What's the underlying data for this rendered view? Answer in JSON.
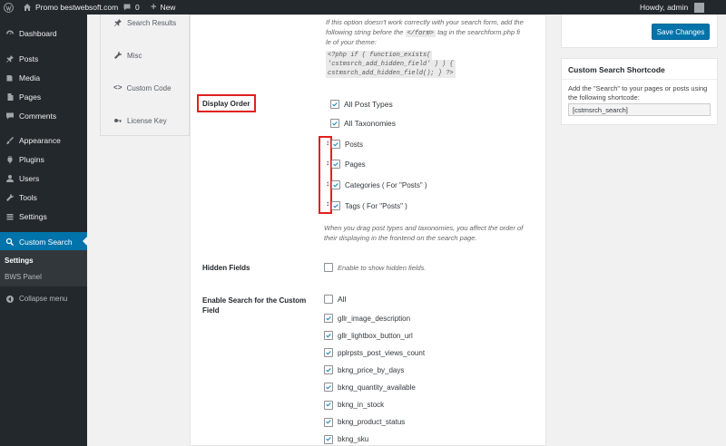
{
  "adminbar": {
    "site_name": "Promo bestwebsoft.com",
    "comments_count": "0",
    "new_label": "New",
    "howdy": "Howdy, admin"
  },
  "sidebar": {
    "items": [
      {
        "label": "Dashboard",
        "icon": "dashboard-icon"
      },
      {
        "label": "Posts",
        "icon": "pin-icon"
      },
      {
        "label": "Media",
        "icon": "media-icon"
      },
      {
        "label": "Pages",
        "icon": "pages-icon"
      },
      {
        "label": "Comments",
        "icon": "comments-icon"
      },
      {
        "label": "Appearance",
        "icon": "brush-icon"
      },
      {
        "label": "Plugins",
        "icon": "plugin-icon"
      },
      {
        "label": "Users",
        "icon": "users-icon"
      },
      {
        "label": "Tools",
        "icon": "wrench-icon"
      },
      {
        "label": "Settings",
        "icon": "settings-icon"
      },
      {
        "label": "Custom Search",
        "icon": "search-icon"
      }
    ],
    "submenu": [
      "Settings",
      "BWS Panel"
    ],
    "collapse": "Collapse menu"
  },
  "tabs": [
    {
      "label": "Search Results",
      "icon": "pin-icon"
    },
    {
      "label": "Misc",
      "icon": "wrench-icon"
    },
    {
      "label": "Custom Code",
      "icon": "code-icon"
    },
    {
      "label": "License Key",
      "icon": "key-icon"
    }
  ],
  "note_top": {
    "line1": "If this option doesn't work correctly with your search form, add the",
    "line2_a": "following string before the",
    "line2_code": "</form>",
    "line2_b": "tag in the searchform.php fi",
    "line3": "le of your theme:",
    "code1": "<?php if ( function_exists(",
    "code2": "'cstmsrch_add_hidden_field' ) ) {",
    "code3": "cstmsrch_add_hidden_field(); } ?>"
  },
  "display_order": {
    "label": "Display Order",
    "all_post_types": "All Post Types",
    "all_taxonomies": "All Taxonomies",
    "items": [
      "Posts",
      "Pages",
      "Categories ( For \"Posts\" )",
      "Tags ( For \"Posts\" )"
    ],
    "drag_glyph": "↕",
    "note_line1": "When you drag post types and taxonomies, you affect the order of",
    "note_line2": "their displaying in the frontend on the search page."
  },
  "hidden_fields": {
    "label": "Hidden Fields",
    "checkbox_label": "Enable to show hidden fields."
  },
  "custom_field": {
    "label_line1": "Enable Search for the Custom",
    "label_line2": "Field",
    "all_label": "All",
    "fields": [
      "gllr_image_description",
      "gllr_lightbox_button_url",
      "pplrpsts_post_views_count",
      "bkng_price_by_days",
      "bkng_quantity_available",
      "bkng_in_stock",
      "bkng_product_status",
      "bkng_sku"
    ]
  },
  "side": {
    "save_label": "Save Changes",
    "shortcode_title": "Custom Search Shortcode",
    "shortcode_desc": "Add the \"Search\" to your pages or posts using the following shortcode:",
    "shortcode_value": "[cstmsrch_search]"
  },
  "colors": {
    "accent": "#0073aa",
    "highlight": "#e02020",
    "sidebar": "#23282d"
  }
}
